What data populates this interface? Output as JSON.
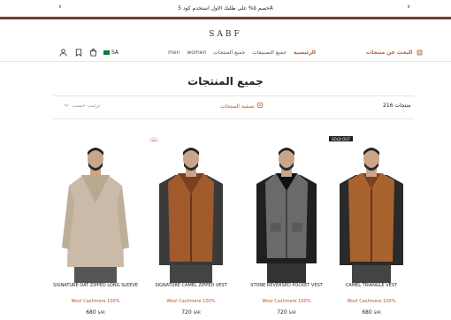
{
  "announcement": {
    "text": "خصم ٥% على طلبك الاول استخدم كود 5A",
    "prev": "‹",
    "next": "›"
  },
  "brand": {
    "logo": "SABF"
  },
  "header": {
    "currency": "SA",
    "search_label": "البحث عن منتجات",
    "menu": [
      "الرئيسية",
      "جميع التصنيفات",
      "جميع المنتجات",
      "women",
      "men"
    ]
  },
  "page": {
    "title": "جميع المنتجات",
    "count": "216 منتجات",
    "filter_label": "تصفية المنتجات",
    "sort_label": "ترتيب حسب"
  },
  "products": [
    {
      "name": "Signature Oat Zipped Long Sleeve",
      "material": "Wool Cashmere 100%",
      "price": "680",
      "currency": "SAR",
      "sold_out": false,
      "color": "#c9bba7"
    },
    {
      "name": "Signature Camel Zipped Vest",
      "material": "Wool Cashmere 100%",
      "price": "720",
      "currency": "SAR",
      "sold_out": false,
      "color": "#a05a2c"
    },
    {
      "name": "Stone Reversed Pocket Vest",
      "material": "Wool Cashmere 100%",
      "price": "720",
      "currency": "SAR",
      "sold_out": false,
      "color": "#6a6a6a"
    },
    {
      "name": "Camel Triangle Vest",
      "material": "Wool Cashmere 100%",
      "price": "680",
      "currency": "SAR",
      "sold_out": true,
      "badge": "SOLD OUT",
      "color": "#a8632e"
    }
  ],
  "colors": {
    "accent": "#b35a2a",
    "stripe": "#7a3a2a"
  }
}
